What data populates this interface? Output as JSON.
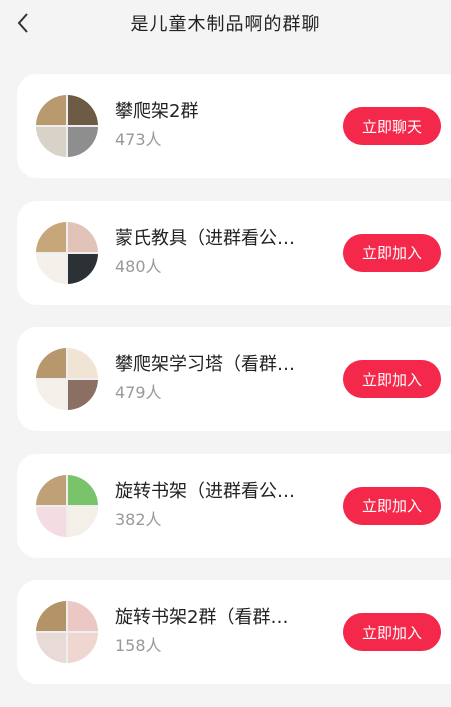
{
  "header": {
    "title": "是儿童木制品啊的群聊"
  },
  "groups": [
    {
      "name": "攀爬架2群",
      "count": "473人",
      "button": "立即聊天",
      "colors": [
        "#b99a6f",
        "#6e5b45",
        "#d8d2c8",
        "#8e8e8e"
      ]
    },
    {
      "name": "蒙氏教具（进群看公…",
      "count": "480人",
      "button": "立即加入",
      "colors": [
        "#c7a67a",
        "#e2c3b8",
        "#f3f1ea",
        "#2c3135"
      ]
    },
    {
      "name": "攀爬架学习塔（看群…",
      "count": "479人",
      "button": "立即加入",
      "colors": [
        "#b6986c",
        "#f0e4d4",
        "#f6f0ea",
        "#8b6f62"
      ]
    },
    {
      "name": "旋转书架（进群看公…",
      "count": "382人",
      "button": "立即加入",
      "colors": [
        "#bfa077",
        "#79c46a",
        "#f3dde2",
        "#f4efe7"
      ]
    },
    {
      "name": "旋转书架2群（看群…",
      "count": "158人",
      "button": "立即加入",
      "colors": [
        "#b49467",
        "#ecc8c4",
        "#e8dbd7",
        "#f0d6d0"
      ]
    }
  ]
}
